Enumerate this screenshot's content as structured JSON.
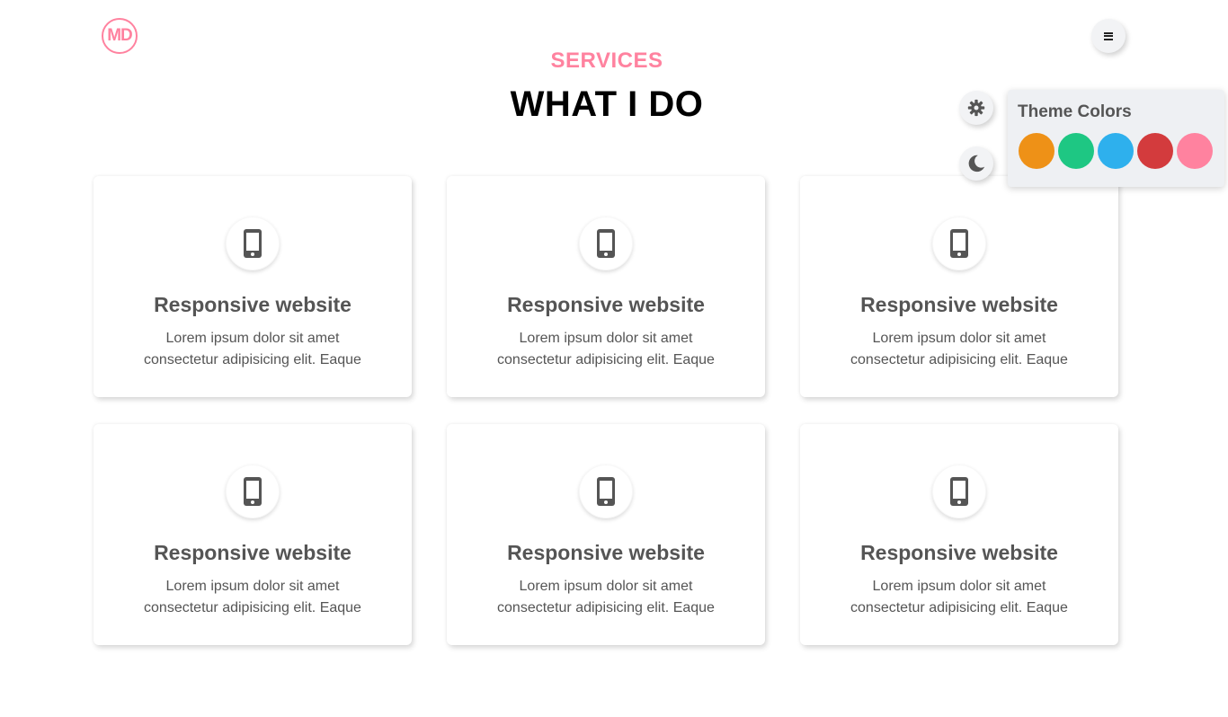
{
  "logo": {
    "text": "MD"
  },
  "header": {
    "menu_icon": "hamburger-icon"
  },
  "section": {
    "subtitle": "SERVICES",
    "title": "WHAT I DO"
  },
  "theme_controls": {
    "settings_icon": "gear-icon",
    "dark_mode_icon": "moon-icon",
    "panel_title": "Theme Colors",
    "colors": [
      "#ee9117",
      "#1ec783",
      "#2eb0ed",
      "#d33b3d",
      "#ff829f"
    ]
  },
  "services": [
    {
      "icon": "mobile-phone-icon",
      "title": "Responsive website",
      "line1": "Lorem ipsum dolor sit amet",
      "line2": "consectetur adipisicing elit. Eaque"
    },
    {
      "icon": "mobile-phone-icon",
      "title": "Responsive website",
      "line1": "Lorem ipsum dolor sit amet",
      "line2": "consectetur adipisicing elit. Eaque"
    },
    {
      "icon": "mobile-phone-icon",
      "title": "Responsive website",
      "line1": "Lorem ipsum dolor sit amet",
      "line2": "consectetur adipisicing elit. Eaque"
    },
    {
      "icon": "mobile-phone-icon",
      "title": "Responsive website",
      "line1": "Lorem ipsum dolor sit amet",
      "line2": "consectetur adipisicing elit. Eaque"
    },
    {
      "icon": "mobile-phone-icon",
      "title": "Responsive website",
      "line1": "Lorem ipsum dolor sit amet",
      "line2": "consectetur adipisicing elit. Eaque"
    },
    {
      "icon": "mobile-phone-icon",
      "title": "Responsive website",
      "line1": "Lorem ipsum dolor sit amet",
      "line2": "consectetur adipisicing elit. Eaque"
    }
  ]
}
